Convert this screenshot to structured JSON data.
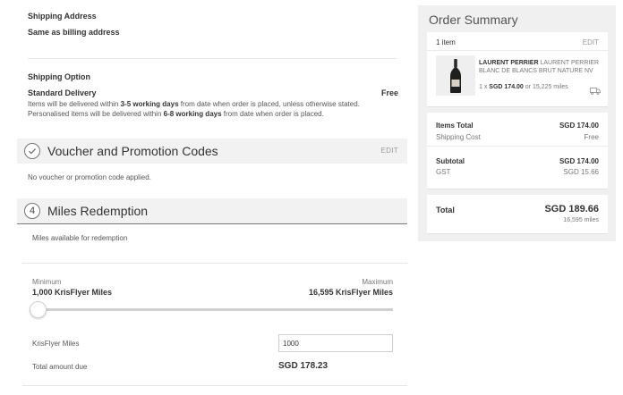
{
  "shipping_address": {
    "title": "Shipping Address",
    "value": "Same as billing address"
  },
  "shipping_option": {
    "title": "Shipping Option",
    "method": "Standard Delivery",
    "price": "Free",
    "line1_pre": "Items will be delivered within ",
    "line1_bold": "3-5 working days",
    "line1_post": " from date when order is placed, unless otherwise stated.",
    "line2_pre": "Personalised items will be delivered within ",
    "line2_bold": "6-8 working days",
    "line2_post": " from date when order is placed."
  },
  "voucher": {
    "title": "Voucher and Promotion Codes",
    "edit": "EDIT",
    "status": "No voucher or promotion code applied."
  },
  "miles": {
    "step": "4",
    "title": "Miles Redemption",
    "available_label": "Miles available for redemption",
    "min_label": "Minimum",
    "max_label": "Maximum",
    "min_value": "1,000 KrisFlyer Miles",
    "max_value": "16,595 KrisFlyer Miles",
    "slider_fraction": 0,
    "input_label": "KrisFlyer Miles",
    "input_value": "1000",
    "due_label": "Total amount due",
    "due_value": "SGD 178.23"
  },
  "summary": {
    "title": "Order Summary",
    "item_count": "1 item",
    "edit": "EDIT",
    "product_brand": "LAURENT PERRIER",
    "product_name": " LAURENT PERRIER BLANC DE BLANCS BRUT NATURE NV",
    "qty_prefix": "1 x ",
    "price": "SGD 174.00",
    "price_alt": " or 15,225 miles",
    "items_total_label": "Items Total",
    "items_total_value": "SGD 174.00",
    "shipping_label": "Shipping Cost",
    "shipping_value": "Free",
    "subtotal_label": "Subtotal",
    "subtotal_value": "SGD 174.00",
    "gst_label": "GST",
    "gst_value": "SGD 15.66",
    "total_label": "Total",
    "total_value": "SGD 189.66",
    "total_miles": "16,595 miles"
  },
  "icons": {
    "voucher_status": "check-circle-icon",
    "shipping": "truck-icon"
  }
}
